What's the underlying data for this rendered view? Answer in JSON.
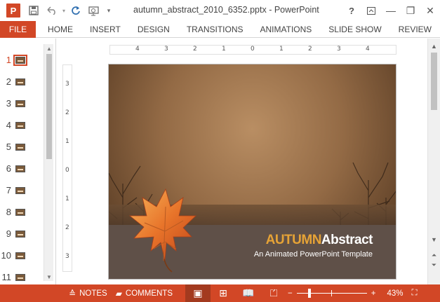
{
  "app": {
    "title": "autumn_abstract_2010_6352.pptx - PowerPoint",
    "icon_letter": "P"
  },
  "quick_access": {
    "save_icon": "save-icon",
    "undo_icon": "undo-icon",
    "redo_icon": "redo-icon",
    "start_from_beginning_icon": "presentation-icon",
    "customize_icon": "chevron-down-icon"
  },
  "window_controls": {
    "help": "?",
    "ribbon_display": "ribbon-display-icon",
    "minimize": "—",
    "restore": "❐",
    "close": "✕"
  },
  "ribbon": {
    "file": "FILE",
    "tabs": [
      "HOME",
      "INSERT",
      "DESIGN",
      "TRANSITIONS",
      "ANIMATIONS",
      "SLIDE SHOW",
      "REVIEW"
    ]
  },
  "thumbnails": {
    "active": 1,
    "items": [
      "1",
      "2",
      "3",
      "4",
      "5",
      "6",
      "7",
      "8",
      "9",
      "10",
      "11"
    ]
  },
  "ruler": {
    "horizontal": [
      "4",
      "3",
      "2",
      "1",
      "0",
      "1",
      "2",
      "3",
      "4"
    ],
    "vertical": [
      "3",
      "2",
      "1",
      "0",
      "1",
      "2",
      "3"
    ]
  },
  "slide": {
    "title_part1": "AUTUMN",
    "title_part2": "Abstract",
    "subtitle": "An Animated PowerPoint Template",
    "colors": {
      "title_accent": "#e6a336",
      "band": "#5f5048"
    }
  },
  "status": {
    "notes": "NOTES",
    "comments": "COMMENTS",
    "zoom_minus": "−",
    "zoom_plus": "+",
    "zoom_percent": "43%",
    "zoom_level": 0.43,
    "accent_color": "#d24726"
  }
}
